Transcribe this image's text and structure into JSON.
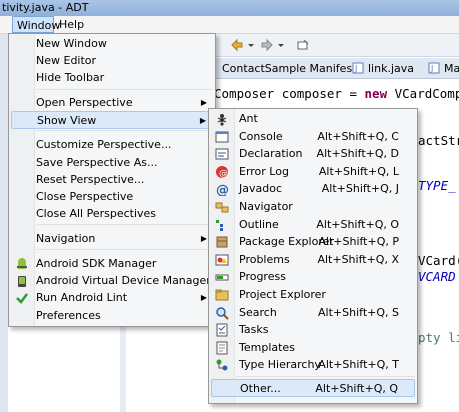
{
  "window": {
    "title": "tivity.java - ADT"
  },
  "menubar": {
    "window_label": "Window",
    "help_label": "Help"
  },
  "editor": {
    "tabs": [
      "ContactSample Manifest",
      "link.java",
      "Ma"
    ],
    "code_lines": [
      {
        "pre": "Composer composer = ",
        "kw": "new",
        "post": " VCardCompo"
      },
      {
        "pre": "",
        "kw": "",
        "post": "actStr"
      },
      {
        "pre": "",
        "kw": "",
        "post": "TYPE_"
      },
      {
        "pre": "",
        "kw": "",
        "post": "VCard("
      },
      {
        "pre": "",
        "kw": "",
        "post": "VCARD"
      },
      {
        "pre": "",
        "kw": "",
        "post": "pty li"
      }
    ]
  },
  "window_menu": {
    "items": [
      {
        "label": "New Window"
      },
      {
        "label": "New Editor"
      },
      {
        "label": "Hide Toolbar"
      },
      {
        "label": "Open Perspective",
        "submenu": true
      },
      {
        "label": "Show View",
        "submenu": true,
        "highlighted": true
      },
      {
        "label": "Customize Perspective..."
      },
      {
        "label": "Save Perspective As..."
      },
      {
        "label": "Reset Perspective..."
      },
      {
        "label": "Close Perspective"
      },
      {
        "label": "Close All Perspectives"
      },
      {
        "label": "Navigation",
        "submenu": true
      },
      {
        "label": "Android SDK Manager",
        "icon": "android-sdk-icon"
      },
      {
        "label": "Android Virtual Device Manager",
        "icon": "android-avd-icon"
      },
      {
        "label": "Run Android Lint",
        "icon": "lint-check-icon",
        "submenu": true
      },
      {
        "label": "Preferences"
      }
    ]
  },
  "show_view_menu": {
    "items": [
      {
        "label": "Ant",
        "shortcut": "",
        "icon": "ant-icon"
      },
      {
        "label": "Console",
        "shortcut": "Alt+Shift+Q, C",
        "icon": "console-icon"
      },
      {
        "label": "Declaration",
        "shortcut": "Alt+Shift+Q, D",
        "icon": "declaration-icon"
      },
      {
        "label": "Error Log",
        "shortcut": "Alt+Shift+Q, L",
        "icon": "error-log-icon"
      },
      {
        "label": "Javadoc",
        "shortcut": "Alt+Shift+Q, J",
        "icon": "javadoc-icon"
      },
      {
        "label": "Navigator",
        "shortcut": "",
        "icon": "navigator-icon"
      },
      {
        "label": "Outline",
        "shortcut": "Alt+Shift+Q, O",
        "icon": "outline-icon"
      },
      {
        "label": "Package Explorer",
        "shortcut": "Alt+Shift+Q, P",
        "icon": "package-explorer-icon"
      },
      {
        "label": "Problems",
        "shortcut": "Alt+Shift+Q, X",
        "icon": "problems-icon"
      },
      {
        "label": "Progress",
        "shortcut": "",
        "icon": "progress-icon"
      },
      {
        "label": "Project Explorer",
        "shortcut": "",
        "icon": "project-explorer-icon"
      },
      {
        "label": "Search",
        "shortcut": "Alt+Shift+Q, S",
        "icon": "search-icon"
      },
      {
        "label": "Tasks",
        "shortcut": "",
        "icon": "tasks-icon"
      },
      {
        "label": "Templates",
        "shortcut": "",
        "icon": "templates-icon"
      },
      {
        "label": "Type Hierarchy",
        "shortcut": "Alt+Shift+Q, T",
        "icon": "type-hierarchy-icon"
      },
      {
        "label": "Other...",
        "shortcut": "Alt+Shift+Q, Q",
        "icon": ""
      }
    ]
  }
}
